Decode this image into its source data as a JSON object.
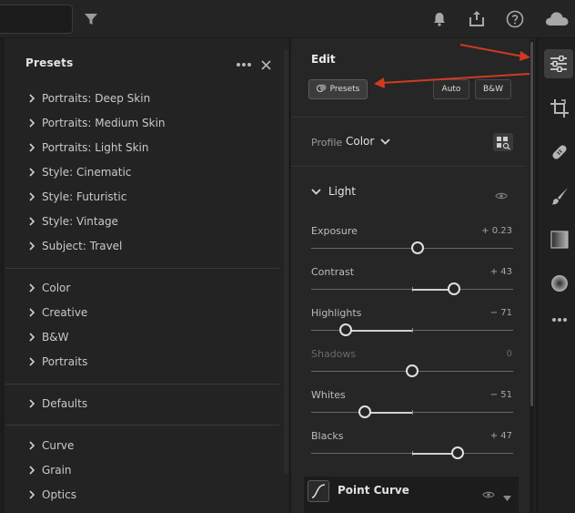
{
  "presets_panel": {
    "title": "Presets",
    "group1": [
      {
        "label": "Portraits: Deep Skin"
      },
      {
        "label": "Portraits: Medium Skin"
      },
      {
        "label": "Portraits: Light Skin"
      },
      {
        "label": "Style: Cinematic"
      },
      {
        "label": "Style: Futuristic"
      },
      {
        "label": "Style: Vintage"
      },
      {
        "label": "Subject: Travel"
      }
    ],
    "group2": [
      {
        "label": "Color"
      },
      {
        "label": "Creative"
      },
      {
        "label": "B&W"
      },
      {
        "label": "Portraits"
      }
    ],
    "group3": [
      {
        "label": "Defaults"
      }
    ],
    "group4": [
      {
        "label": "Curve"
      },
      {
        "label": "Grain"
      },
      {
        "label": "Optics"
      }
    ]
  },
  "edit_panel": {
    "title": "Edit",
    "presets_button": "Presets",
    "auto_button": "Auto",
    "bw_button": "B&W",
    "profile_label": "Profile",
    "profile_value": "Color",
    "light_section": "Light",
    "sliders": [
      {
        "label": "Exposure",
        "value": "+ 0.23",
        "position": 0.525
      },
      {
        "label": "Contrast",
        "value": "+ 43",
        "position": 0.705
      },
      {
        "label": "Highlights",
        "value": "− 71",
        "position": 0.17
      },
      {
        "label": "Shadows",
        "value": "0",
        "position": 0.5
      },
      {
        "label": "Whites",
        "value": "− 51",
        "position": 0.265
      },
      {
        "label": "Blacks",
        "value": "+ 47",
        "position": 0.725
      }
    ],
    "point_curve_label": "Point Curve"
  },
  "colors": {
    "annotation_arrow": "#d03a22",
    "panel_bg": "#262626",
    "accent_active_tool": "#3e3e3e"
  }
}
